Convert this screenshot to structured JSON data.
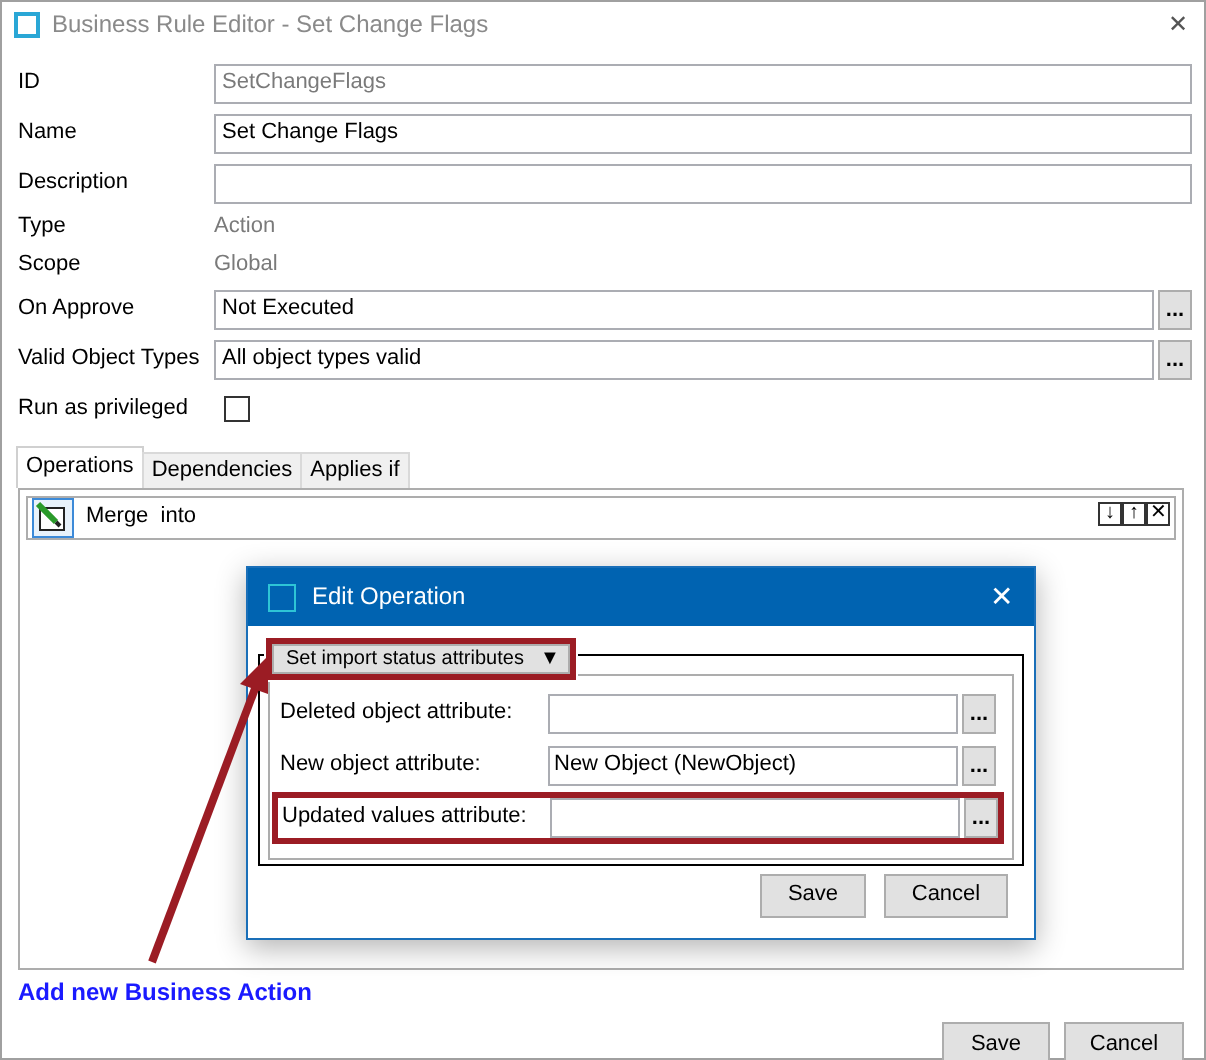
{
  "window": {
    "title": "Business Rule Editor - Set Change Flags",
    "close": "✕"
  },
  "fields": [
    {
      "kind": "input",
      "label": "ID",
      "value": "SetChangeFlags",
      "disabled": true
    },
    {
      "kind": "input",
      "label": "Name",
      "value": "Set Change Flags",
      "disabled": false
    },
    {
      "kind": "input",
      "label": "Description"
    },
    {
      "kind": "text",
      "label": "Type",
      "value": "Action"
    },
    {
      "kind": "text",
      "label": "Scope",
      "value": "Global"
    },
    {
      "kind": "picker",
      "label": "On Approve",
      "value": "Not Executed",
      "button": "..."
    },
    {
      "kind": "picker",
      "label": "Valid Object Types",
      "value": "All object types valid",
      "button": "..."
    },
    {
      "kind": "checkbox",
      "label": "Run as privileged",
      "checked": false
    }
  ],
  "tabs": [
    {
      "label": "Operations",
      "selected": true
    },
    {
      "label": "Dependencies",
      "selected": false
    },
    {
      "label": "Applies if",
      "selected": false
    }
  ],
  "operations": [
    {
      "label": "Merge  into"
    }
  ],
  "operation_controls": [
    "↓",
    "↑",
    "✕"
  ],
  "link": "Add new Business Action",
  "buttons": [
    "Save",
    "Cancel"
  ],
  "dialog": {
    "title": "Edit Operation",
    "close": "✕",
    "mode": {
      "label": "Set import status attributes",
      "caret": "▼",
      "highlighted": true
    },
    "fields": [
      {
        "label": "Deleted object attribute:",
        "button": "...",
        "highlighted": false
      },
      {
        "label": "New object attribute:",
        "value": "New Object (NewObject)",
        "button": "...",
        "highlighted": false
      },
      {
        "label": "Updated values attribute:",
        "button": "...",
        "highlighted": true
      }
    ],
    "buttons": [
      "Save",
      "Cancel"
    ]
  }
}
